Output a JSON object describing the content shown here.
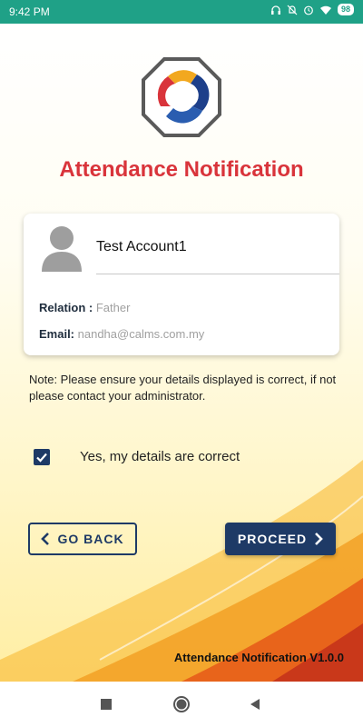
{
  "status_bar": {
    "time": "9:42 PM",
    "battery": "98"
  },
  "header": {
    "title": "Attendance Notification"
  },
  "profile": {
    "name": "Test Account1",
    "relation_label": "Relation :",
    "relation_value": "Father",
    "email_label": "Email:",
    "email_value": "nandha@calms.com.my"
  },
  "note": "Note: Please ensure your details displayed is correct, if not please contact your administrator.",
  "confirm": {
    "label": "Yes, my details are correct",
    "checked": true
  },
  "buttons": {
    "back": "GO BACK",
    "proceed": "PROCEED"
  },
  "footer": {
    "version": "Attendance Notification V1.0.0"
  },
  "colors": {
    "accent": "#1e3a66",
    "title": "#d9343b",
    "status_bar": "#1fa187"
  },
  "icons": [
    "headphones-icon",
    "mute-icon",
    "alarm-icon",
    "wifi-icon",
    "checkbox-check-icon",
    "chevron-left-icon",
    "chevron-right-icon",
    "recent-apps-icon",
    "home-icon",
    "back-icon"
  ]
}
